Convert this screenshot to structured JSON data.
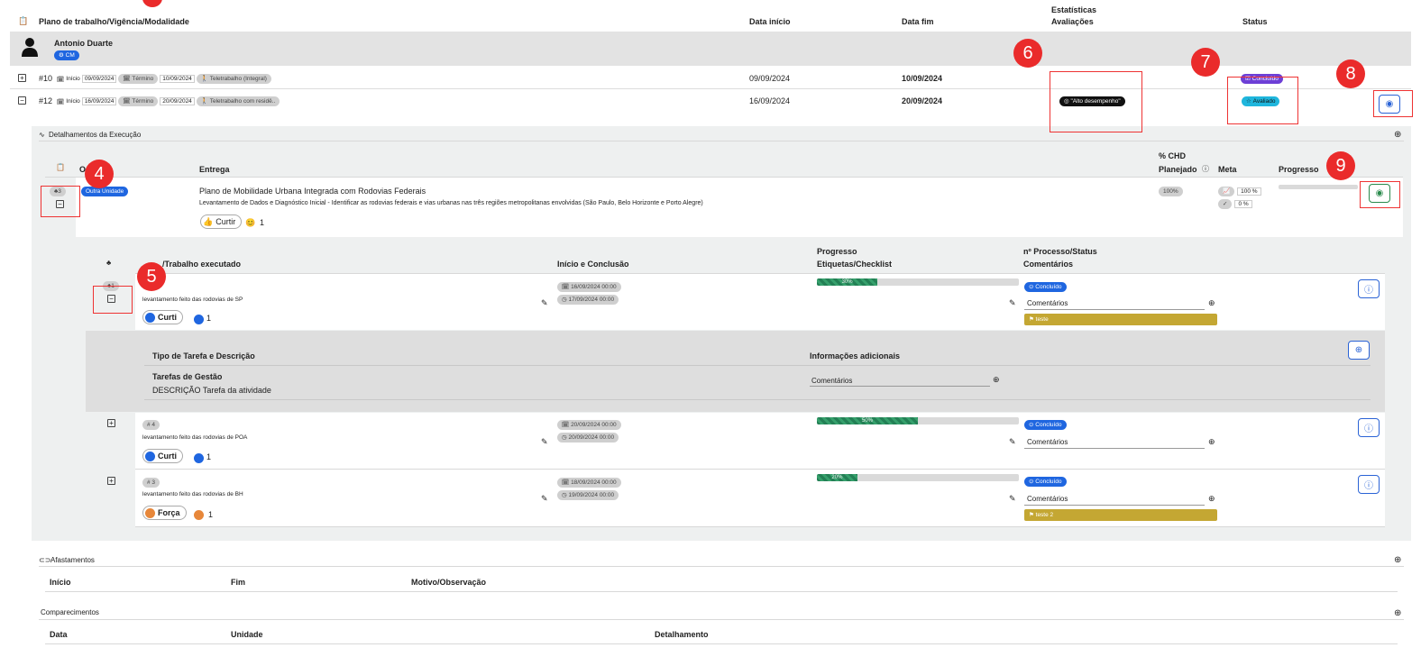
{
  "header": {
    "col_plano": "Plano de trabalho/Vigência/Modalidade",
    "col_inicio": "Data início",
    "col_fim": "Data fim",
    "col_estat_1": "Estatísticas",
    "col_estat_2": "Avaliações",
    "col_status": "Status"
  },
  "user": {
    "name": "Antonio Duarte",
    "badge": "CM"
  },
  "plans": [
    {
      "id": "#10",
      "inicio_label": "Início",
      "inicio": "09/09/2024",
      "termino_label": "Término",
      "termino": "10/09/2024",
      "modalidade": "Teletrabalho (Integral)",
      "data_inicio": "09/09/2024",
      "data_fim": "10/09/2024",
      "status": "Concluído"
    },
    {
      "id": "#12",
      "inicio_label": "Início",
      "inicio": "16/09/2024",
      "termino_label": "Término",
      "termino": "20/09/2024",
      "modalidade": "Teletrabalho com residê..",
      "data_inicio": "16/09/2024",
      "data_fim": "20/09/2024",
      "avaliacao": "\"Alto desempenho\"",
      "status": "Avaliado"
    }
  ],
  "markers": [
    "4",
    "5",
    "6",
    "7",
    "8",
    "9"
  ],
  "detalhamentos": {
    "title": "Detalhamentos da Execução",
    "col_o": "O",
    "col_entrega": "Entrega",
    "col_chd_1": "% CHD",
    "col_chd_2": "Planejado",
    "col_meta": "Meta",
    "col_progresso": "Progresso"
  },
  "entrega": {
    "count": "3",
    "unidade": "Outra Unidade",
    "title": "Plano de Mobilidade Urbana Integrada com Rodovias Federais",
    "desc": "Levantamento de Dados e Diagnóstico Inicial - Identificar as rodovias federais e vias urbanas nas três regiões metropolitanas envolvidas (São Paulo, Belo Horizonte e Porto Alegre)",
    "like_label": "Curtir",
    "like_count": "1",
    "chd": "100%",
    "meta": "100 %",
    "meta2": "0 %"
  },
  "trabalho_header": {
    "col_trabalho": "Trabalho executado",
    "col_trab_prefix": "/",
    "col_inicio": "Início e Conclusão",
    "col_prog_1": "Progresso",
    "col_prog_2": "Etiquetas/Checklist",
    "col_proc_1": "nº Processo/Status",
    "col_proc_2": "Comentários"
  },
  "atividades": [
    {
      "num": "1",
      "desc": "levantamento feito das rodovias de SP",
      "inicio": "16/09/2024 00:00",
      "fim": "17/09/2024 00:00",
      "progress": 30,
      "progress_label": "30%",
      "status": "Concluído",
      "comentarios": "Comentários",
      "tag": "teste",
      "reaction": "Curti",
      "reaction_count": "1"
    },
    {
      "num": "# 4",
      "desc": "levantamento feito das rodovias de POA",
      "inicio": "20/09/2024 00:00",
      "fim": "20/09/2024 00:00",
      "progress": 50,
      "progress_label": "50%",
      "status": "Concluído",
      "comentarios": "Comentários",
      "reaction": "Curti",
      "reaction_count": "1"
    },
    {
      "num": "# 3",
      "desc": "levantamento feito das rodovias de BH",
      "inicio": "18/09/2024 00:00",
      "fim": "19/09/2024 00:00",
      "progress": 20,
      "progress_label": "20%",
      "status": "Concluído",
      "comentarios": "Comentários",
      "tag": "teste 2",
      "reaction": "Força",
      "reaction_count": "1"
    }
  ],
  "tarefa": {
    "col_tipo": "Tipo de Tarefa e Descrição",
    "col_info": "Informações adicionais",
    "tipo": "Tarefas de Gestão",
    "desc": "DESCRIÇÃO Tarefa da atividade",
    "comentarios": "Comentários"
  },
  "afastamentos": {
    "title": "Afastamentos",
    "col_inicio": "Início",
    "col_fim": "Fim",
    "col_motivo": "Motivo/Observação"
  },
  "comparecimentos": {
    "title": "Comparecimentos",
    "col_data": "Data",
    "col_unidade": "Unidade",
    "col_detalhamento": "Detalhamento"
  },
  "colors": {
    "accent": "#1f66e0",
    "marker": "#ea2b2b",
    "progress": "#238055",
    "tag": "#c4a733"
  }
}
